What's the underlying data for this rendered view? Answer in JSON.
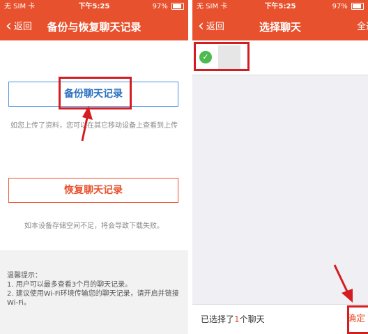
{
  "left_screen": {
    "status": {
      "carrier": "无 SIM 卡",
      "time": "下午5:25",
      "battery": "97%"
    },
    "nav": {
      "back": "返回",
      "title": "备份与恢复聊天记录"
    },
    "backup_button": "备份聊天记录",
    "backup_hint": "如您上传了资料，您可以在其它移动设备上查看到上传",
    "restore_button": "恢复聊天记录",
    "restore_hint": "如本设备存储空间不足，将会导致下载失败。",
    "tips": {
      "title": "温馨提示：",
      "line1": "1. 用户可以最多查看3个月的聊天记录。",
      "line2": "2. 建议使用Wi-Fi环境传输您的聊天记录，请开启并链接Wi-Fi。"
    }
  },
  "right_screen": {
    "status": {
      "carrier": "无 SIM 卡",
      "time": "下午5:25",
      "battery": "97%"
    },
    "nav": {
      "back": "返回",
      "title": "选择聊天",
      "right": "全选"
    },
    "selected_prefix": "已选择了",
    "selected_count": "1",
    "selected_suffix": "个聊天",
    "confirm": "确定"
  },
  "colors": {
    "brand": "#e8512d",
    "annotation": "#d41d22",
    "check": "#4cba4d",
    "backup_border": "#4a90d9"
  }
}
